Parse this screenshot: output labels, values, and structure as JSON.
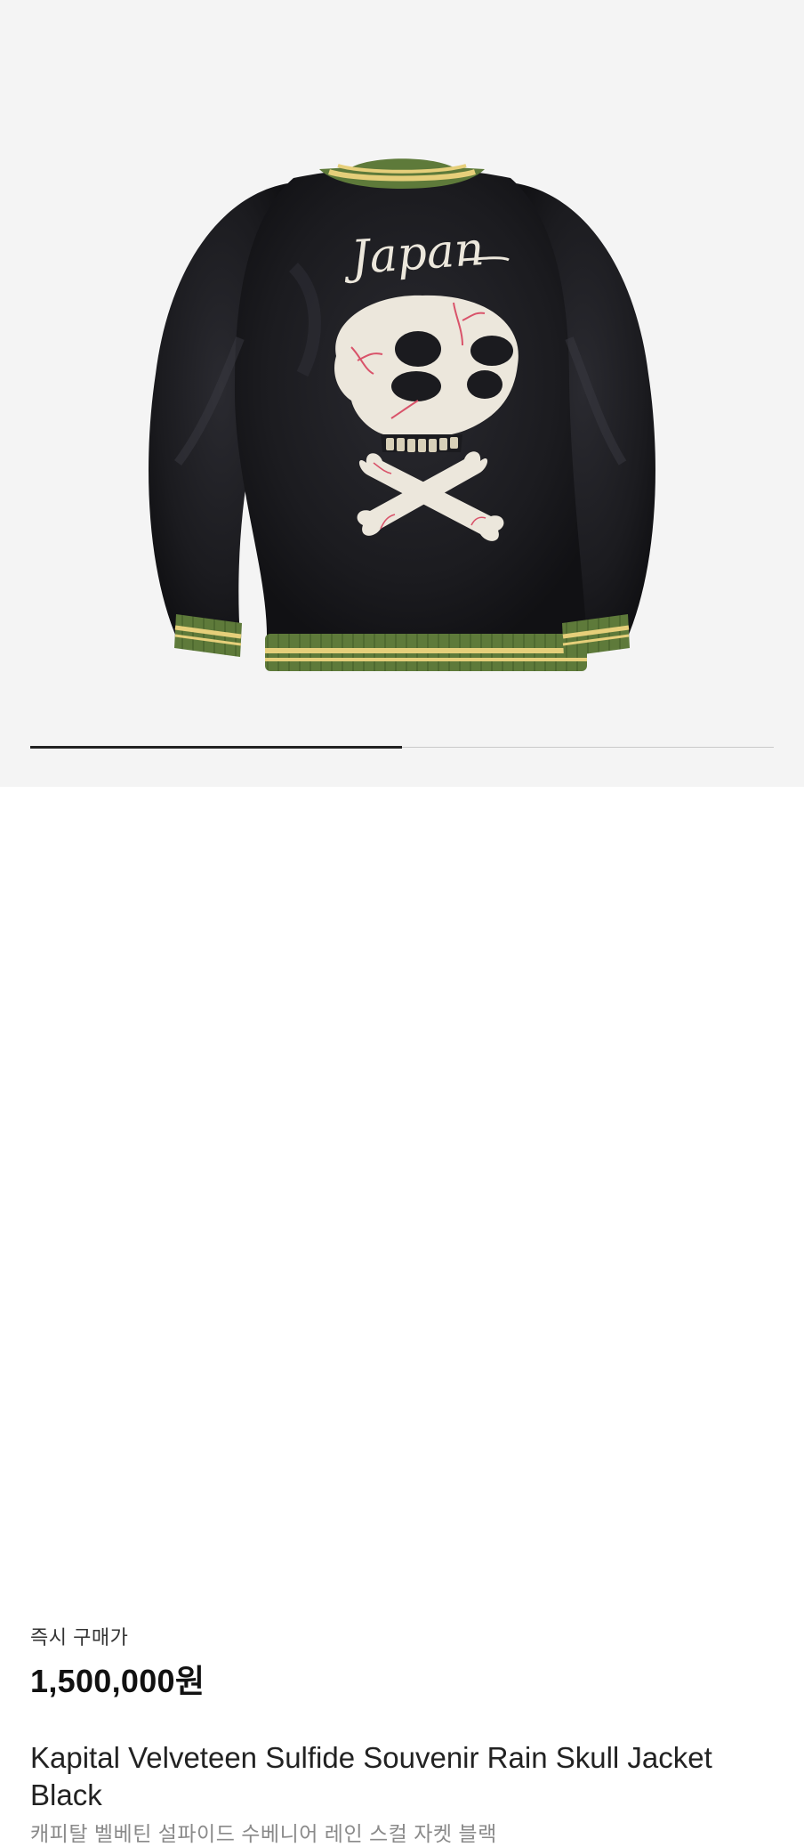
{
  "gallery": {
    "image_label": "Japan",
    "image_count": 2,
    "current_index": 1,
    "progress": 0.5
  },
  "product": {
    "price_label": "즉시 구매가",
    "price": "1,500,000원",
    "title_en": "Kapital Velveteen Sulfide Souvenir Rain Skull Jacket Black",
    "title_ko": "캐피탈 벨베틴 설파이드 수베니어 레인 스컬 자켓 블랙"
  },
  "colors": {
    "page_bg": "#ffffff",
    "gallery_bg": "#f4f4f4",
    "jacket": "#1c1c20",
    "rib_green": "#5e7a3a",
    "rib_yellow": "#e6cf7a",
    "embroidery": "#ece7dc",
    "vein": "#d9536a"
  }
}
